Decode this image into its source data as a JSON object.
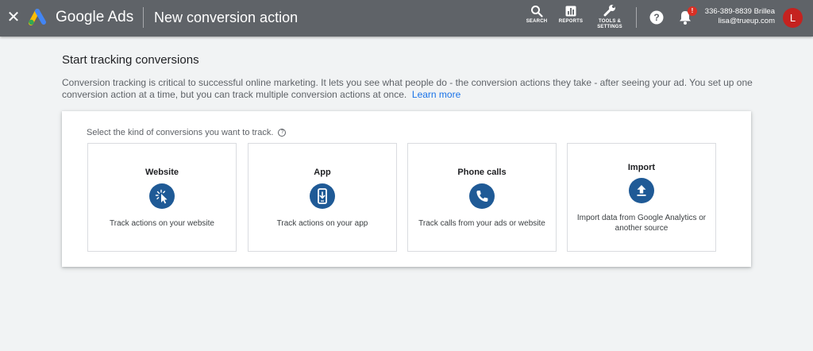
{
  "header": {
    "close_glyph": "✕",
    "product_name": "Google Ads",
    "page_title": "New conversion action",
    "tools": [
      {
        "label": "SEARCH",
        "icon": "search-icon"
      },
      {
        "label": "REPORTS",
        "icon": "reports-icon"
      },
      {
        "label": "TOOLS &\nSETTINGS",
        "icon": "wrench-icon"
      }
    ],
    "help_icon": "help-icon",
    "notification_badge": "!",
    "account_phone": "336-389-8839 Brillea",
    "account_email": "lisa@trueup.com",
    "avatar_letter": "L",
    "colors": {
      "bar": "#5f6368",
      "badge": "#d93025",
      "avatar": "#c5221f"
    }
  },
  "main": {
    "title": "Start tracking conversions",
    "description": "Conversion tracking is critical to successful online marketing. It lets you see what people do - the conversion actions they take - after seeing your ad. You set up one conversion action at a time, but you can track multiple conversion actions at once.",
    "learn_more": "Learn more",
    "prompt": "Select the kind of conversions you want to track.",
    "prompt_help": "?",
    "options": [
      {
        "title": "Website",
        "description": "Track actions on your website",
        "icon": "website-click-icon"
      },
      {
        "title": "App",
        "description": "Track actions on your app",
        "icon": "mobile-app-icon"
      },
      {
        "title": "Phone calls",
        "description": "Track calls from your ads or website",
        "icon": "phone-icon"
      },
      {
        "title": "Import",
        "description": "Import data from Google Analytics or another source",
        "icon": "upload-icon"
      }
    ],
    "colors": {
      "accent": "#1a73e8",
      "icon_circle": "#1f5a96"
    }
  }
}
